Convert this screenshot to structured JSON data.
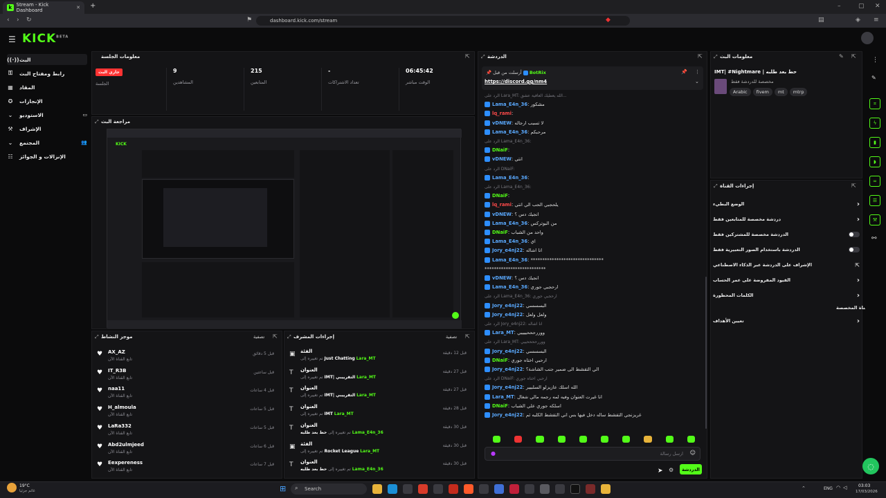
{
  "browser": {
    "tab_title": "Stream - Kick Dashboard",
    "new_tab": "+",
    "url": "dashboard.kick.com/stream"
  },
  "app": {
    "logo": "KICK",
    "logo_sup": "BETA"
  },
  "sidebar": {
    "items": [
      {
        "label": "البث",
        "icon": "live-icon",
        "active": true
      },
      {
        "label": "رابط ومفتاح البث",
        "icon": "key-icon"
      },
      {
        "label": "المقاد",
        "icon": "grid-icon"
      },
      {
        "label": "الإنجازات",
        "icon": "achievements-icon"
      },
      {
        "label": "الاستوديو",
        "icon": "studio-icon"
      },
      {
        "label": "الإشراف",
        "icon": "moderation-icon"
      },
      {
        "label": "المجتمع",
        "icon": "community-icon"
      },
      {
        "label": "الإنزالات و الجوائز",
        "icon": "drops-icon"
      }
    ]
  },
  "session": {
    "title": "معلومات الجلسة",
    "stats": [
      {
        "label": "الوقت مباشر",
        "value": "06:45:42"
      },
      {
        "label": "تعداد الاشتراكات",
        "value": "-"
      },
      {
        "label": "المتابعين",
        "value": "215"
      },
      {
        "label": "المشاهدين",
        "value": "9"
      },
      {
        "label": "الجلسة",
        "badge": "جاري البث"
      }
    ]
  },
  "preview": {
    "title": "مراجعة البث"
  },
  "activity": {
    "title": "موجز النشاط",
    "filter_label": "تصفية",
    "items": [
      {
        "name": "AX_AZ",
        "sub": "تابع القناة الآن",
        "time": "قبل 5 دقائق"
      },
      {
        "name": "IT_R3B",
        "sub": "تابع القناة الآن",
        "time": "قبل ساعتين"
      },
      {
        "name": "naa11",
        "sub": "تابع القناة الآن",
        "time": "قبل 4 ساعات"
      },
      {
        "name": "H_almoula",
        "sub": "تابع القناة الآن",
        "time": "قبل 5 ساعات"
      },
      {
        "name": "LaRa332",
        "sub": "تابع القناة الآن",
        "time": "قبل 5 ساعات"
      },
      {
        "name": "Abd2ulmjeed",
        "sub": "تابع القناة الآن",
        "time": "قبل 6 ساعات"
      },
      {
        "name": "Eexpereness",
        "sub": "تابع القناة الآن",
        "time": "قبل 7 ساعات"
      }
    ]
  },
  "modactions": {
    "title": "إجراءات المشرف",
    "filter_label": "تصفية",
    "items": [
      {
        "head": "الفئة",
        "prefix": "تم تغييره إلى",
        "value": "Just Chatting",
        "by": "Lara_MT",
        "time": "قبل 12 دقيقة"
      },
      {
        "head": "العنوان",
        "prefix": "تم تغييره إلى",
        "value": "IMT| التقرييبي",
        "by": "Lara_MT",
        "time": "قبل 27 دقيقة"
      },
      {
        "head": "العنوان",
        "prefix": "تم تغييره إلى",
        "value": "IMT| التقرييبي",
        "by": "Lara_MT",
        "time": "قبل 27 دقيقة"
      },
      {
        "head": "العنوان",
        "prefix": "تم تغييره إلى",
        "value": "IMT",
        "by": "Lara_MT",
        "time": "قبل 28 دقيقة"
      },
      {
        "head": "العنوان",
        "prefix": "تم تغييره إلى",
        "value": "حط بعد طلبه",
        "by": "Lama_E4n_36",
        "time": "قبل 30 دقيقة"
      },
      {
        "head": "الفئة",
        "prefix": "تم تغييره إلى",
        "value": "Rocket League",
        "by": "Lara_MT",
        "time": "قبل 30 دقيقة"
      },
      {
        "head": "العنوان",
        "prefix": "تم تغييره إلى",
        "value": "حط بعد طلبه",
        "by": "Lama_E4n_36",
        "time": "قبل 30 دقيقة"
      }
    ]
  },
  "chat": {
    "title": "الدردشة",
    "pinned_by": "BotRix",
    "pinned_label": "أرسلت من قبل",
    "pinned_link": "https://discord.gg/nm4",
    "messages": [
      {
        "user": "",
        "text": "الرد على Lara_MT: الله يعطيك العافية عشق...",
        "color": "#77777e",
        "reply": true
      },
      {
        "user": "Lama_E4n_36",
        "text": "مشكور",
        "color": "#5aa9ff"
      },
      {
        "user": "lq_rami",
        "text": "",
        "color": "#ff4a4a"
      },
      {
        "user": "vDNEW",
        "text": "لا تسبب ارجاله",
        "color": "#5aa9ff"
      },
      {
        "user": "Lama_E4n_36",
        "text": "مرحبكم",
        "color": "#5aa9ff"
      },
      {
        "user": "",
        "text": "الرد على Lama_E4n_36:",
        "color": "#77777e",
        "reply": true
      },
      {
        "user": "DNaiF",
        "text": "",
        "color": "#53fc18"
      },
      {
        "user": "vDNEW",
        "text": "انتي",
        "color": "#5aa9ff"
      },
      {
        "user": "",
        "text": "الرد على DNaiF:",
        "color": "#77777e",
        "reply": true
      },
      {
        "user": "Lama_E4n_36",
        "text": "",
        "color": "#5aa9ff"
      },
      {
        "user": "",
        "text": "الرد على Lama_E4n_36:",
        "color": "#77777e",
        "reply": true
      },
      {
        "user": "DNaiF",
        "text": "",
        "color": "#53fc18"
      },
      {
        "user": "lq_rami",
        "text": "يلحجبي الحب الي انتي",
        "color": "#ff4a4a"
      },
      {
        "user": "vDNEW",
        "text": "انجيك دس ؟",
        "color": "#5aa9ff"
      },
      {
        "user": "Lama_E4n_36",
        "text": "من البوتركس",
        "color": "#5aa9ff"
      },
      {
        "user": "DNaiF",
        "text": "واحد من الشباب",
        "color": "#53fc18"
      },
      {
        "user": "Lama_E4n_36",
        "text": "اي",
        "color": "#5aa9ff"
      },
      {
        "user": "Jory_e4nj22",
        "text": "انا اشاله",
        "color": "#5aa9ff"
      },
      {
        "user": "Lama_E4n_36",
        "text": "*******************************",
        "color": "#5aa9ff"
      },
      {
        "user": "",
        "text": "**************************",
        "color": "#ddd"
      },
      {
        "user": "vDNEW",
        "text": "انجيك دس ؟",
        "color": "#5aa9ff"
      },
      {
        "user": "Lama_E4n_36",
        "text": "ارحجبي جوري",
        "color": "#5aa9ff"
      },
      {
        "user": "",
        "text": "الرد على Lama_E4n_36: ارحجبي جوري",
        "color": "#77777e",
        "reply": true
      },
      {
        "user": "Jory_e4nj22",
        "text": "البسسسي",
        "color": "#5aa9ff"
      },
      {
        "user": "Jory_e4nj22",
        "text": "ولعل ولعل",
        "color": "#5aa9ff"
      },
      {
        "user": "",
        "text": "الرد على Jory_e4nj22: انا اشاله",
        "color": "#77777e",
        "reply": true
      },
      {
        "user": "Lara_MT",
        "text": "ووررحححييييي",
        "color": "#5aa9ff"
      },
      {
        "user": "",
        "text": "الرد على Lara_MT: ووررححححييي",
        "color": "#77777e",
        "reply": true
      },
      {
        "user": "Jory_e4nj22",
        "text": "البسسسي",
        "color": "#5aa9ff"
      },
      {
        "user": "DNaiF",
        "text": "ارحبي اختاه جوري",
        "color": "#53fc18"
      },
      {
        "user": "Jory_e4nj22",
        "text": "الي التقشط الى ضمير جنب الشاشة؟",
        "color": "#5aa9ff"
      },
      {
        "user": "",
        "text": "الرد على DNaiF: ارحبي اختاه جوري",
        "color": "#77777e",
        "reply": true
      },
      {
        "user": "Jory_e4nj22",
        "text": "الله اسلك عازيزلو السلبيير",
        "color": "#5aa9ff"
      },
      {
        "user": "Lara_MT",
        "text": "انا غيرت العنوان وفيه لمه رجمه مالي شغال",
        "color": "#5aa9ff"
      },
      {
        "user": "DNaiF",
        "text": "اسلكه جوري علي الشباب",
        "color": "#53fc18"
      },
      {
        "user": "Jory_e4nj22",
        "text": "غريزنجي التقشط ساله دخل فيها بس اني التقشط الكلبه ثم",
        "color": "#5aa9ff"
      }
    ],
    "input_placeholder": "ارسل رسالة",
    "send_label": "الدردشة"
  },
  "streaminfo": {
    "title": "معلومات البث",
    "stream_title": "IMT| #Nightmare | حط بعد طلبه",
    "subtitle": "مخصصة للدردشة فقط",
    "tags": [
      "Arabic",
      "fivem",
      "mt",
      "mtrp"
    ]
  },
  "channel_actions": {
    "title": "إجراءات القناة",
    "rows": [
      {
        "label": "الوضع البطيء",
        "control": "chevron"
      },
      {
        "label": "دردشة مخصصة للمتابعين فقط",
        "control": "chevron"
      },
      {
        "label": "الدردشة مخصصة للمشتركين فقط",
        "control": "toggle"
      },
      {
        "label": "الدردشة باستخدام الصور التعبيرية فقط",
        "control": "toggle"
      },
      {
        "label": "الإشراف على الدردشة عبر الذكاء الاصطناعي",
        "control": "link"
      },
      {
        "label": "القيود المفروضة على عمر الحساب",
        "control": "chevron"
      },
      {
        "label": "الكلمات المحظورة",
        "control": "chevron"
      }
    ],
    "section": "القناة المخصصة",
    "goals_label": "تعيين الأهداف"
  },
  "taskbar": {
    "weather": "19°C",
    "weather_sub": "غائم جزئيا",
    "search": "Search",
    "lang": "ENG",
    "time": "03:03",
    "date": "17/03/2026"
  }
}
